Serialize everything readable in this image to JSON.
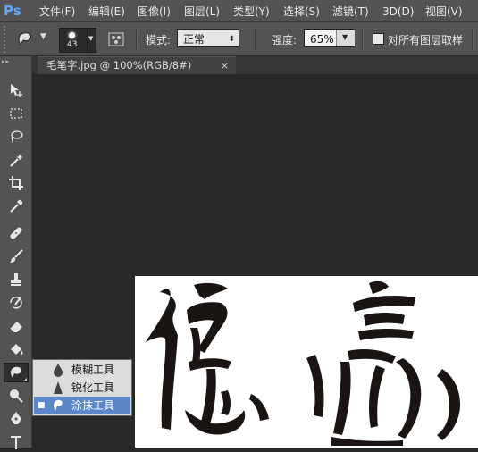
{
  "app": {
    "logo": "Ps"
  },
  "menu": [
    "文件(F)",
    "编辑(E)",
    "图像(I)",
    "图层(L)",
    "类型(Y)",
    "选择(S)",
    "滤镜(T)",
    "3D(D)",
    "视图(V)"
  ],
  "options": {
    "brush_size": "43",
    "mode_label": "模式:",
    "mode_value": "正常",
    "strength_label": "强度:",
    "strength_value": "65%",
    "sample_all_label": "对所有图层取样"
  },
  "tab": {
    "title": "毛笔字.jpg @ 100%(RGB/8#)",
    "close": "×"
  },
  "flyout": {
    "items": [
      {
        "label": "模糊工具",
        "icon": "blur-drop-icon",
        "selected": false
      },
      {
        "label": "锐化工具",
        "icon": "sharpen-triangle-icon",
        "selected": false
      },
      {
        "label": "涂抹工具",
        "icon": "smudge-finger-icon",
        "selected": true
      }
    ],
    "bullet": "■"
  },
  "tools": [
    "move-tool-icon",
    "marquee-tool-icon",
    "lasso-tool-icon",
    "magic-wand-tool-icon",
    "crop-tool-icon",
    "eyedropper-tool-icon",
    "healing-brush-tool-icon",
    "brush-tool-icon",
    "clone-stamp-tool-icon",
    "history-brush-tool-icon",
    "eraser-tool-icon",
    "paint-bucket-tool-icon",
    "smudge-tool-icon",
    "dodge-tool-icon",
    "pen-tool-icon",
    "type-tool-icon"
  ],
  "colors": {
    "accent": "#5fa8ff",
    "selection": "#5b86c9"
  }
}
